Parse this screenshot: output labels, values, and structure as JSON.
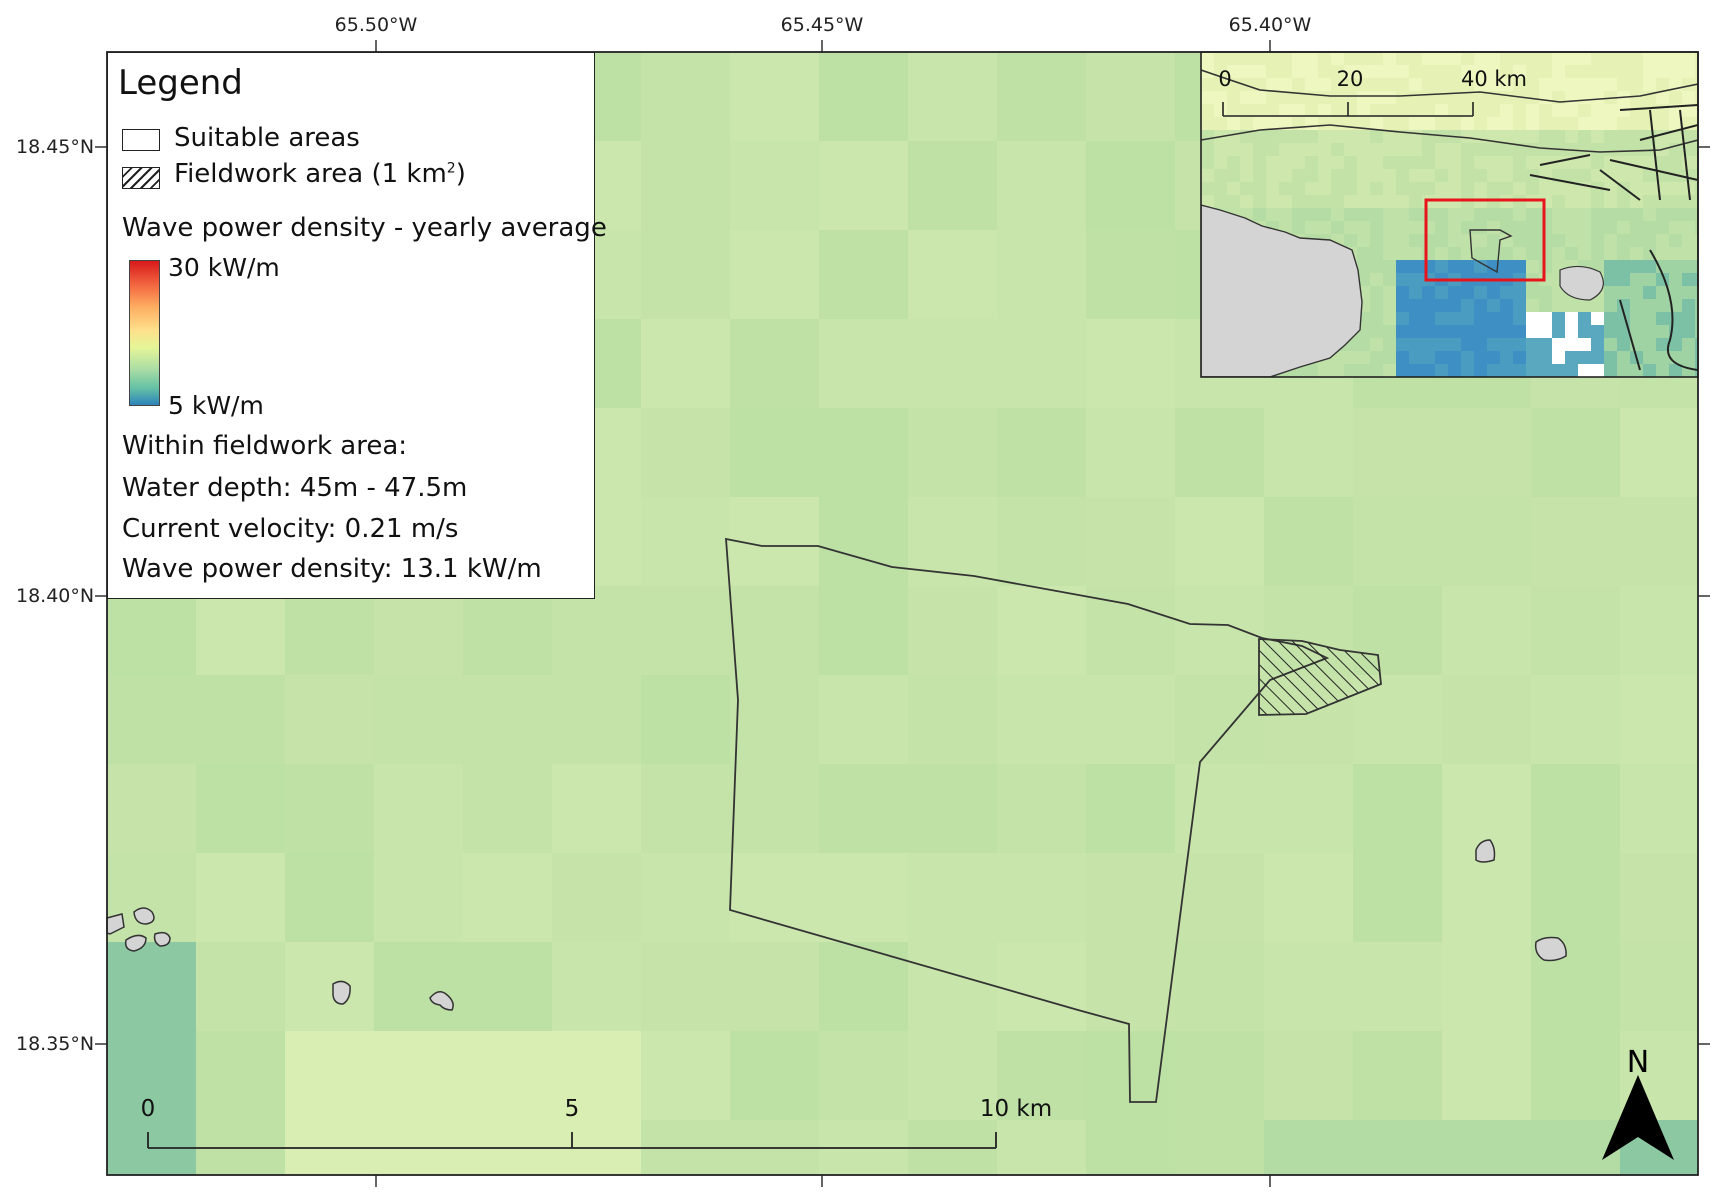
{
  "legend": {
    "title": "Legend",
    "suitable_label": "Suitable areas",
    "fieldwork_label": "Fieldwork area (1 km",
    "fieldwork_sup": "2",
    "fieldwork_close": ")",
    "wave_title": "Wave power density - yearly average",
    "ramp_max": "30 kW/m",
    "ramp_min": "5 kW/m",
    "within_title": "Within fieldwork area:",
    "water_depth": "Water depth: 45m - 47.5m",
    "current_velocity": "Current velocity: 0.21 m/s",
    "wave_power": "Wave power density: 13.1 kW/m"
  },
  "graticule": {
    "longitudes": [
      "65.50°W",
      "65.45°W",
      "65.40°W"
    ],
    "latitudes": [
      "18.45°N",
      "18.40°N",
      "18.35°N"
    ]
  },
  "scalebar": {
    "labels": [
      "0",
      "5",
      "10 km"
    ]
  },
  "inset": {
    "scalebar_labels": [
      "0",
      "20",
      "40 km"
    ]
  },
  "north_arrow": {
    "label": "N"
  },
  "colors": {
    "ramp": [
      "#d7191c",
      "#f46d43",
      "#fdae61",
      "#fee08b",
      "#e6f598",
      "#abdda4",
      "#66c2a5",
      "#2b83ba"
    ],
    "land": "#d4d4d4",
    "extent_box": "#e8141c",
    "background_sea": "#c2e2a8"
  }
}
